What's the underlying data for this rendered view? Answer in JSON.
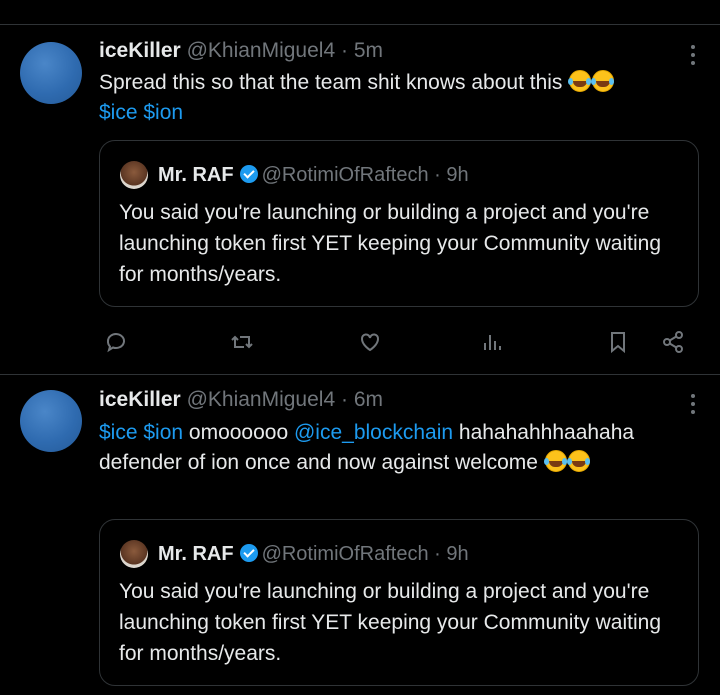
{
  "tweets": [
    {
      "name": "iceKiller",
      "handle": "@KhianMiguel4",
      "sep": " · ",
      "time": "5m",
      "text_plain": "Spread this so that the team shit knows about this ",
      "tags": "$ice $ion",
      "quote": {
        "name": "Mr. RAF",
        "handle": "@RotimiOfRaftech",
        "sep": " · ",
        "time": "9h",
        "text": "You said you're launching or building a project and you're launching token first YET keeping your Community waiting for months/years."
      }
    },
    {
      "name": "iceKiller",
      "handle": "@KhianMiguel4",
      "sep": " · ",
      "time": "6m",
      "tags": "$ice $ion",
      "text_mid": " omoooooo ",
      "mention": "@ice_blockchain",
      "text_rest": " hahahahhhaahaha defender of ion once and now against welcome ",
      "quote": {
        "name": "Mr. RAF",
        "handle": "@RotimiOfRaftech",
        "sep": " · ",
        "time": "9h",
        "text": "You said you're launching or building a project and you're launching token first YET keeping your Community waiting for months/years."
      }
    }
  ],
  "icons": {
    "reply": "reply-icon",
    "retweet": "retweet-icon",
    "like": "like-icon",
    "views": "views-icon",
    "bookmark": "bookmark-icon",
    "share": "share-icon",
    "more": "more-icon"
  },
  "colors": {
    "background": "#000000",
    "link": "#1d9bf0",
    "muted": "#71767b",
    "divider": "#2f3336"
  }
}
